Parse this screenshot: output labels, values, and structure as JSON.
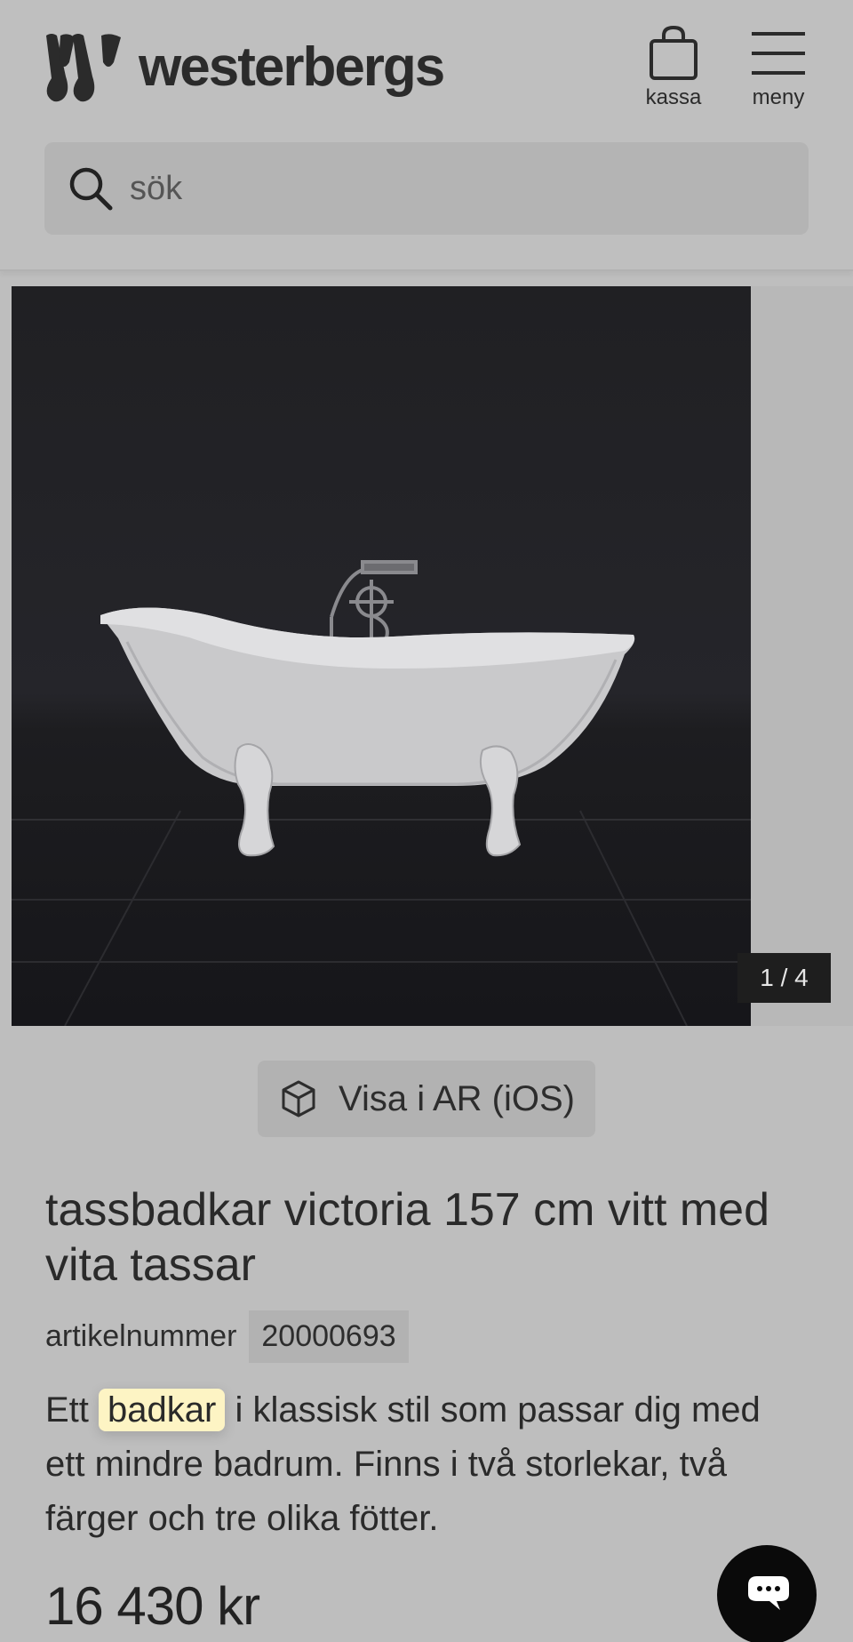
{
  "header": {
    "brand": "westerbergs",
    "cart_label": "kassa",
    "menu_label": "meny",
    "search_placeholder": "sök"
  },
  "gallery": {
    "counter": "1 / 4",
    "current_index": 1,
    "total": 4
  },
  "product": {
    "ar_button_label": "Visa i AR (iOS)",
    "title": "tassbadkar victoria 157 cm vitt med vita tassar",
    "article_label": "artikelnummer",
    "article_number": "20000693",
    "description_before": "Ett",
    "description_highlight": "badkar",
    "description_after": "i klassisk stil som passar dig med ett mindre badrum. Finns i två storlekar, två färger och tre olika fötter.",
    "price": "16 430 kr"
  },
  "colors": {
    "background": "#bebebe",
    "text": "#2a2a2a",
    "highlight": "#fdf4c4",
    "chat_button": "#0a0a0a"
  },
  "icons": [
    "westerbergs-logo-icon",
    "shopping-bag-icon",
    "hamburger-menu-icon",
    "search-icon",
    "ar-cube-icon",
    "chat-icon"
  ]
}
